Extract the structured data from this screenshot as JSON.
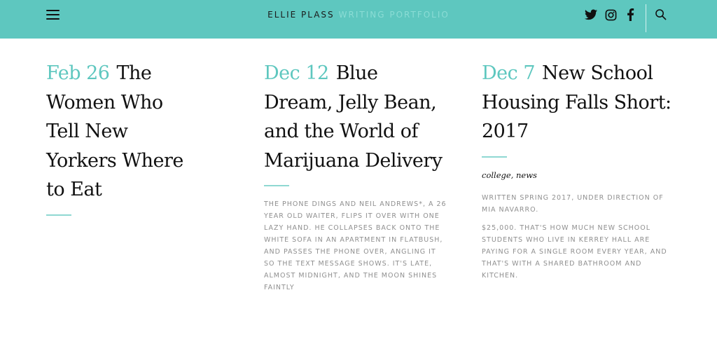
{
  "header": {
    "site_name": "ELLIE PLASS",
    "site_tagline": "WRITING PORTFOLIO",
    "colors": {
      "accent": "#5ec7bf",
      "tagline": "#8bdcd5"
    },
    "icons": [
      "menu-icon",
      "twitter-icon",
      "instagram-icon",
      "facebook-icon",
      "search-icon"
    ]
  },
  "posts": [
    {
      "date": "Feb 26",
      "title": "The Women Who Tell New Yorkers Where to Eat"
    },
    {
      "date": "Dec 12",
      "title": "Blue Dream, Jelly Bean, and the World of Marijuana Delivery",
      "excerpt": "THE PHONE DINGS AND NEIL ANDREWS*, A 26 YEAR OLD WAITER, FLIPS IT OVER WITH ONE LAZY HAND. HE COLLAPSES BACK ONTO THE WHITE SOFA IN AN APARTMENT IN FLATBUSH, AND PASSES THE PHONE OVER, ANGLING IT SO THE TEXT MESSAGE SHOWS. IT'S LATE, ALMOST MIDNIGHT, AND THE MOON SHINES FAINTLY"
    },
    {
      "date": "Dec 7",
      "title": "New School Housing Falls Short: 2017",
      "tags": "college, news",
      "excerpt_1": "WRITTEN SPRING 2017, UNDER DIRECTION OF MIA NAVARRO.",
      "excerpt_2": "$25,000. THAT'S HOW MUCH NEW SCHOOL STUDENTS WHO LIVE IN KERREY HALL ARE PAYING FOR A SINGLE ROOM EVERY YEAR, AND THAT'S WITH A SHARED BATHROOM AND KITCHEN."
    }
  ]
}
